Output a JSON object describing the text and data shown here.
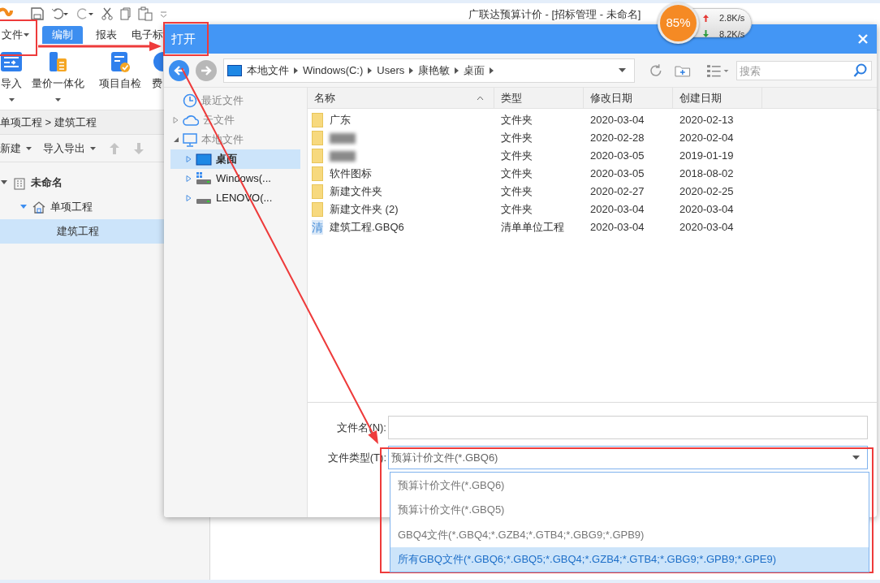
{
  "app": {
    "title": "广联达预算计价 - [招标管理 - 未命名]",
    "menu_tabs": [
      {
        "label": "文件",
        "has_dropdown": true,
        "selected": false
      },
      {
        "label": "编制",
        "has_dropdown": false,
        "selected": true
      },
      {
        "label": "报表",
        "has_dropdown": false,
        "selected": false
      },
      {
        "label": "电子标",
        "has_dropdown": false,
        "selected": false
      }
    ],
    "ribbon": [
      {
        "label": "导入",
        "kind": "import",
        "has_dropdown": true
      },
      {
        "label": "量价一体化",
        "kind": "integrate",
        "has_dropdown": true
      },
      {
        "label": "项目自检",
        "kind": "check",
        "has_dropdown": false
      },
      {
        "label": "费",
        "kind": "fee",
        "has_dropdown": false
      }
    ],
    "breadcrumb": "单项工程 > 建筑工程",
    "toolbar": [
      {
        "label": "新建",
        "kind": "menu",
        "disabled": false
      },
      {
        "label": "导入导出",
        "kind": "menu",
        "disabled": false
      },
      {
        "kind": "up",
        "disabled": true
      },
      {
        "kind": "down",
        "disabled": true
      }
    ],
    "tree": [
      {
        "label": "未命名",
        "kind": "project",
        "expanded": true,
        "selected": false,
        "children": [
          {
            "label": "单项工程",
            "kind": "single",
            "expanded": true,
            "selected": false,
            "children": [
              {
                "label": "建筑工程",
                "kind": "unit",
                "selected": true
              }
            ]
          }
        ]
      }
    ]
  },
  "net_widget": {
    "percent": "85%",
    "upload": "2.8K/s",
    "download": "8.2K/s"
  },
  "dialog": {
    "title": "打开",
    "address": [
      "本地文件",
      "Windows(C:)",
      "Users",
      "康艳敏",
      "桌面"
    ],
    "search": {
      "placeholder": "搜索"
    },
    "sidebar": [
      {
        "label": "最近文件",
        "kind": "recent",
        "selected": false
      },
      {
        "label": "云文件",
        "kind": "cloud",
        "expanded": false,
        "selected": false
      },
      {
        "label": "本地文件",
        "kind": "computer",
        "expanded": true,
        "selected": false,
        "children": [
          {
            "label": "桌面",
            "kind": "desktop",
            "expanded": false,
            "selected": true
          },
          {
            "label": "Windows(...",
            "kind": "system-drive",
            "expanded": false,
            "selected": false
          },
          {
            "label": "LENOVO(...",
            "kind": "drive",
            "expanded": false,
            "selected": false
          }
        ]
      }
    ],
    "columns": [
      {
        "label": "名称",
        "sorted": true
      },
      {
        "label": "类型",
        "sorted": false
      },
      {
        "label": "修改日期",
        "sorted": false
      },
      {
        "label": "创建日期",
        "sorted": false
      }
    ],
    "rows": [
      {
        "kind": "folder",
        "name": "广东",
        "type": "文件夹",
        "modified": "2020-03-04",
        "created": "2020-02-13"
      },
      {
        "kind": "folder",
        "redacted": true,
        "type": "文件夹",
        "modified": "2020-02-28",
        "created": "2020-02-04"
      },
      {
        "kind": "folder",
        "redacted": true,
        "type": "文件夹",
        "modified": "2020-03-05",
        "created": "2019-01-19"
      },
      {
        "kind": "folder",
        "name": "软件图标",
        "type": "文件夹",
        "modified": "2020-03-05",
        "created": "2018-08-02"
      },
      {
        "kind": "folder",
        "name": "新建文件夹",
        "type": "文件夹",
        "modified": "2020-02-27",
        "created": "2020-02-25"
      },
      {
        "kind": "folder",
        "name": "新建文件夹 (2)",
        "type": "文件夹",
        "modified": "2020-03-04",
        "created": "2020-03-04"
      },
      {
        "kind": "file",
        "icon_text": "清",
        "name": "建筑工程.GBQ6",
        "type": "清单单位工程",
        "modified": "2020-03-04",
        "created": "2020-03-04"
      }
    ],
    "filename_label": "文件名(N):",
    "filetype_label": "文件类型(T):",
    "filetype_value": "预算计价文件(*.GBQ6)",
    "filetype_options": [
      {
        "label": "预算计价文件(*.GBQ6)",
        "selected": false
      },
      {
        "label": "预算计价文件(*.GBQ5)",
        "selected": false
      },
      {
        "label": "GBQ4文件(*.GBQ4;*.GZB4;*.GTB4;*.GBG9;*.GPB9)",
        "selected": false
      },
      {
        "label": "所有GBQ文件(*.GBQ6;*.GBQ5;*.GBQ4;*.GZB4;*.GTB4;*.GBG9;*.GPB9;*.GPE9)",
        "selected": true
      }
    ]
  }
}
